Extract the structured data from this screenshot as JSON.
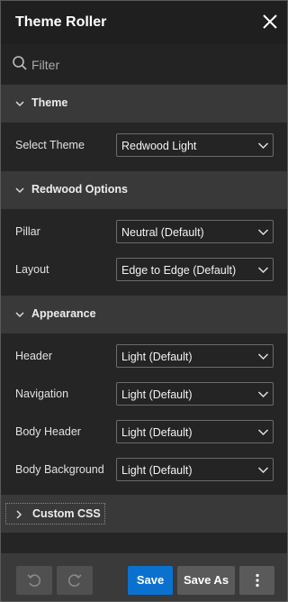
{
  "window": {
    "title": "Theme Roller"
  },
  "filter": {
    "placeholder": "Filter"
  },
  "sections": {
    "theme": {
      "label": "Theme",
      "rows": {
        "select_theme": {
          "label": "Select Theme",
          "value": "Redwood Light"
        }
      }
    },
    "redwood_options": {
      "label": "Redwood Options",
      "rows": {
        "pillar": {
          "label": "Pillar",
          "value": "Neutral (Default)"
        },
        "layout": {
          "label": "Layout",
          "value": "Edge to Edge (Default)"
        }
      }
    },
    "appearance": {
      "label": "Appearance",
      "rows": {
        "header": {
          "label": "Header",
          "value": "Light (Default)"
        },
        "navigation": {
          "label": "Navigation",
          "value": "Light (Default)"
        },
        "body_header": {
          "label": "Body Header",
          "value": "Light (Default)"
        },
        "body_background": {
          "label": "Body Background",
          "value": "Light (Default)"
        }
      }
    },
    "custom_css": {
      "label": "Custom CSS"
    }
  },
  "footer": {
    "save_label": "Save",
    "save_as_label": "Save As"
  },
  "icons": {
    "close": "close-icon",
    "search": "search-icon",
    "chevron_down": "chevron-down-icon",
    "chevron_right": "chevron-right-icon",
    "undo": "undo-icon",
    "redo": "redo-icon",
    "more": "more-vertical-icon"
  },
  "colors": {
    "accent": "#0a72ce",
    "panel_bg": "#252525",
    "section_bg": "#393939"
  }
}
